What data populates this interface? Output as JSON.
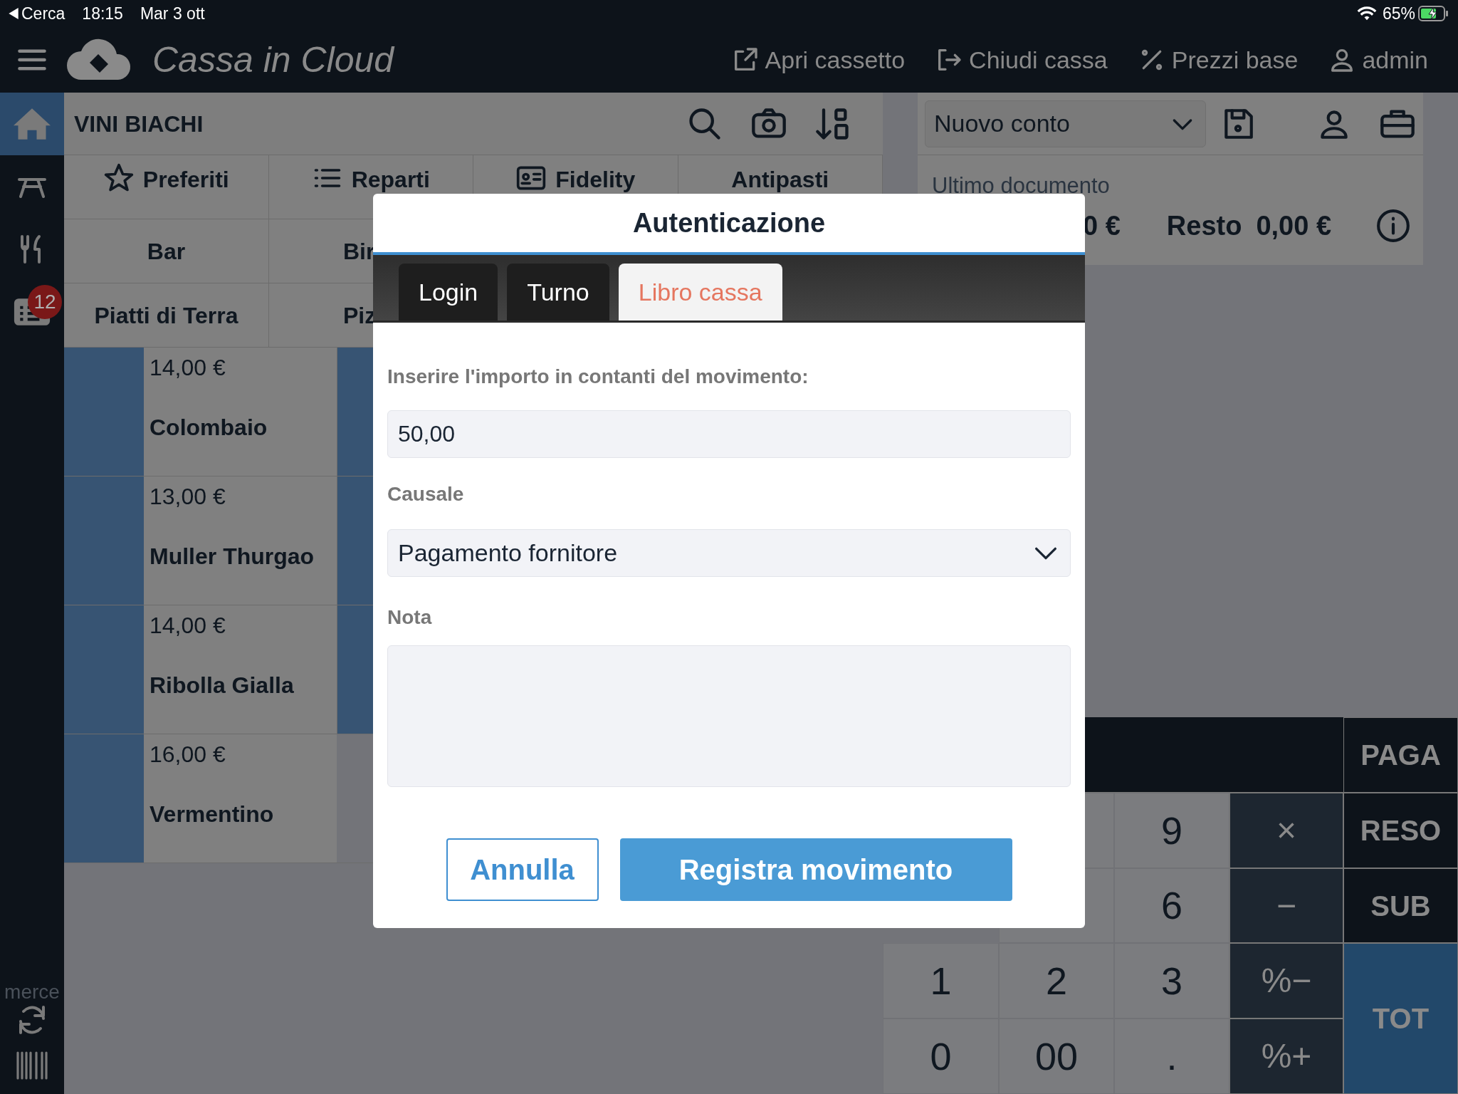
{
  "status_bar": {
    "back": "Cerca",
    "time": "18:15",
    "date": "Mar 3 ott",
    "battery": "65%"
  },
  "header": {
    "logo": "**Cassa** in Cloud",
    "actions": [
      {
        "label": "Apri cassetto",
        "kind": "drawer"
      },
      {
        "label": "Chiudi cassa",
        "kind": "close"
      },
      {
        "label": "Prezzi base",
        "kind": "percent"
      },
      {
        "label": "admin",
        "kind": "user"
      }
    ]
  },
  "sidebar": {
    "items": [
      {
        "kind": "home",
        "selected": true
      },
      {
        "kind": "table",
        "selected": false
      },
      {
        "kind": "dining",
        "selected": false
      },
      {
        "kind": "orders",
        "selected": false,
        "badge": "12"
      }
    ],
    "bottom_items": [
      {
        "kind": "sync",
        "label": "merce"
      },
      {
        "kind": "barcode"
      }
    ]
  },
  "category": {
    "title": "VINI BIACHI"
  },
  "category_tabs": [
    [
      {
        "label": "Preferiti",
        "kind": "star"
      },
      {
        "label": "Reparti",
        "kind": "list"
      },
      {
        "label": "Fidelity",
        "kind": "card"
      },
      {
        "label": "Antipasti",
        "kind": "plain"
      }
    ],
    [
      {
        "label": "Bar",
        "kind": "plain"
      },
      {
        "label": "Bir",
        "kind": "cut"
      }
    ],
    [
      {
        "label": "Piatti di Terra",
        "kind": "plain"
      },
      {
        "label": "Piz",
        "kind": "cut"
      }
    ]
  ],
  "products": [
    [
      {
        "kind": "product",
        "price": "14,00 €",
        "name": "Colombaio"
      },
      {
        "kind": "covered"
      }
    ],
    [
      {
        "kind": "product",
        "price": "13,00 €",
        "name": "Muller Thurgao"
      },
      {
        "kind": "covered"
      }
    ],
    [
      {
        "kind": "product",
        "price": "14,00 €",
        "name": "Ribolla Gialla"
      },
      {
        "kind": "covered"
      }
    ],
    [
      {
        "kind": "product",
        "price": "16,00 €",
        "name": "Vermentino"
      }
    ]
  ],
  "receipt": {
    "account": "Nuovo conto",
    "last_document": "Ultimo documento",
    "total_tail": "0 €",
    "change_label": "Resto",
    "change": "0,00 €"
  },
  "keypad": {
    "rows": [
      [
        "",
        "",
        "",
        "",
        {
          "label": "PAGA",
          "kind": "action"
        }
      ],
      [
        "",
        "",
        {
          "label": "9",
          "kind": "digit"
        },
        {
          "label": "×",
          "kind": "operator"
        },
        {
          "label": "RESO",
          "kind": "action"
        }
      ],
      [
        "",
        "",
        {
          "label": "6",
          "kind": "digit"
        },
        {
          "label": "−",
          "kind": "operator"
        },
        {
          "label": "SUB",
          "kind": "action"
        }
      ],
      [
        {
          "label": "1",
          "kind": "digit"
        },
        {
          "label": "2",
          "kind": "digit"
        },
        {
          "label": "3",
          "kind": "digit"
        },
        {
          "label": "%−",
          "kind": "operator"
        },
        {
          "label": "TOT",
          "kind": "total"
        }
      ],
      [
        {
          "label": "0",
          "kind": "digit"
        },
        {
          "label": "00",
          "kind": "digit"
        },
        {
          "label": ".",
          "kind": "digit"
        },
        {
          "label": "%+",
          "kind": "operator"
        }
      ]
    ]
  },
  "dialog": {
    "title": "Autenticazione",
    "tabs": [
      {
        "label": "Login",
        "selected": false
      },
      {
        "label": "Turno",
        "selected": false
      },
      {
        "label": "Libro cassa",
        "selected": true
      }
    ],
    "amount_label": "Inserire l'importo in contanti del movimento:",
    "amount": "50,00",
    "reason_label": "Causale",
    "reason": "Pagamento fornitore",
    "note_label": "Nota",
    "buttons": [
      {
        "label": "Annulla",
        "kind": "secondary"
      },
      {
        "label": "Registra movimento",
        "kind": "primary"
      }
    ]
  }
}
